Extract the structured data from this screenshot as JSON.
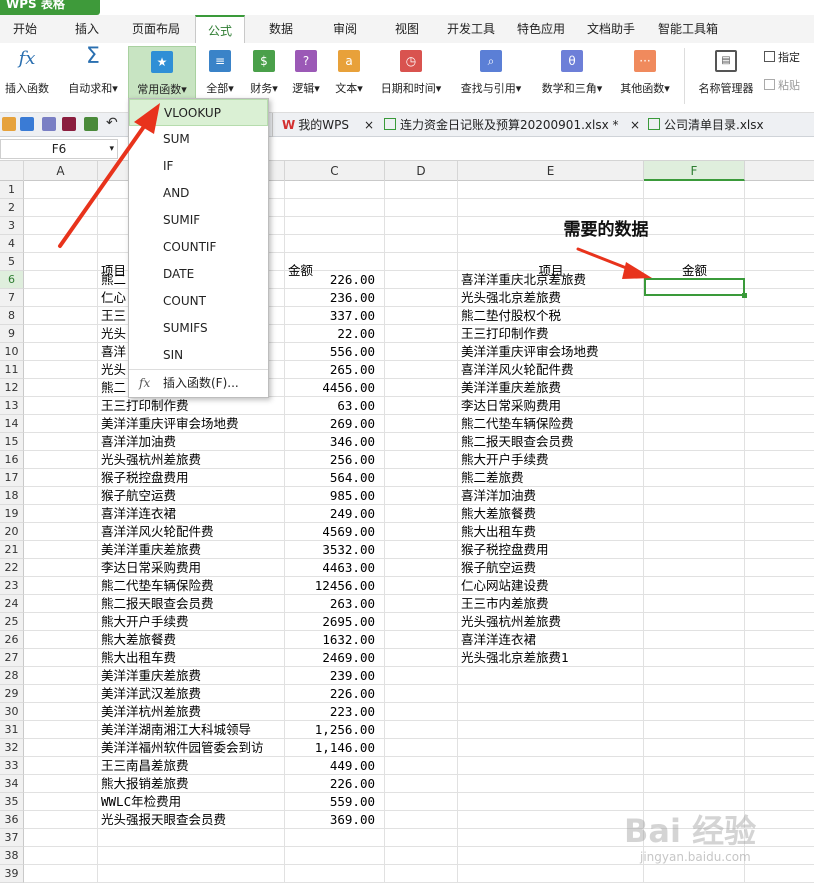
{
  "app": {
    "title": "WPS 表格"
  },
  "ribbon": {
    "tabs": [
      "开始",
      "插入",
      "页面布局",
      "公式",
      "数据",
      "审阅",
      "视图",
      "开发工具",
      "特色应用",
      "文档助手",
      "智能工具箱"
    ],
    "active": "公式"
  },
  "toolbar": {
    "insert_fn": "插入函数",
    "autosum": "自动求和",
    "common_fn": "常用函数",
    "all": "全部",
    "finance": "财务",
    "logic": "逻辑",
    "text": "文本",
    "datetime": "日期和时间",
    "lookup": "查找与引用",
    "math": "数学和三角",
    "other": "其他函数",
    "name_mgr": "名称管理器",
    "assign": "指定",
    "paste": "粘贴",
    "dropdown_glyph": "▾",
    "fx_glyph": "fx",
    "sigma_glyph": "Σ"
  },
  "doc_tabs": [
    "我的WPS",
    "连力资金日记账及预算20200901.xlsx *",
    "公司清单目录.xlsx"
  ],
  "formula_bar": {
    "cell_ref": "F6"
  },
  "columns": [
    "A",
    "B",
    "C",
    "D",
    "E",
    "F"
  ],
  "selected": {
    "col": "F",
    "row": 6
  },
  "menu": {
    "items": [
      "VLOOKUP",
      "SUM",
      "IF",
      "AND",
      "SUMIF",
      "COUNTIF",
      "DATE",
      "COUNT",
      "SUMIFS",
      "SIN"
    ],
    "insert_fn": "插入函数(F)..."
  },
  "sheet": {
    "title_right": "需要的数据",
    "header_item": "项目",
    "header_amount": "金额",
    "left_rows": [
      {
        "row": 6,
        "b": "熊二",
        "c": "226.00"
      },
      {
        "row": 7,
        "b": "仁心",
        "c": "236.00"
      },
      {
        "row": 8,
        "b": "王三",
        "c": "337.00"
      },
      {
        "row": 9,
        "b": "光头",
        "c": "22.00"
      },
      {
        "row": 10,
        "b": "喜洋",
        "c": "556.00"
      },
      {
        "row": 11,
        "b": "光头",
        "c": "265.00"
      },
      {
        "row": 12,
        "b": "熊二",
        "c": "4456.00"
      },
      {
        "row": 13,
        "b": "王三打印制作费",
        "c": "63.00"
      },
      {
        "row": 14,
        "b": "美洋洋重庆评审会场地费",
        "c": "269.00"
      },
      {
        "row": 15,
        "b": "喜洋洋加油费",
        "c": "346.00"
      },
      {
        "row": 16,
        "b": "光头强杭州差旅费",
        "c": "256.00"
      },
      {
        "row": 17,
        "b": "猴子税控盘费用",
        "c": "564.00"
      },
      {
        "row": 18,
        "b": "猴子航空运费",
        "c": "985.00"
      },
      {
        "row": 19,
        "b": "喜洋洋连衣裙",
        "c": "249.00"
      },
      {
        "row": 20,
        "b": "喜洋洋风火轮配件费",
        "c": "4569.00"
      },
      {
        "row": 21,
        "b": "美洋洋重庆差旅费",
        "c": "3532.00"
      },
      {
        "row": 22,
        "b": "李达日常采购费用",
        "c": "4463.00"
      },
      {
        "row": 23,
        "b": "熊二代垫车辆保险费",
        "c": "12456.00"
      },
      {
        "row": 24,
        "b": "熊二报天眼查会员费",
        "c": "263.00"
      },
      {
        "row": 25,
        "b": "熊大开户手续费",
        "c": "2695.00"
      },
      {
        "row": 26,
        "b": "熊大差旅餐费",
        "c": "1632.00"
      },
      {
        "row": 27,
        "b": "熊大出租车费",
        "c": "2469.00"
      },
      {
        "row": 28,
        "b": "美洋洋重庆差旅费",
        "c": "239.00"
      },
      {
        "row": 29,
        "b": "美洋洋武汉差旅费",
        "c": "226.00"
      },
      {
        "row": 30,
        "b": "美洋洋杭州差旅费",
        "c": "223.00"
      },
      {
        "row": 31,
        "b": "美洋洋湖南湘江大科城领导",
        "c": "1,256.00"
      },
      {
        "row": 32,
        "b": "美洋洋福州软件园管委会到访",
        "c": "1,146.00"
      },
      {
        "row": 33,
        "b": "王三南昌差旅费",
        "c": "449.00"
      },
      {
        "row": 34,
        "b": "熊大报销差旅费",
        "c": "226.00"
      },
      {
        "row": 35,
        "b": "WWLC年检费用",
        "c": "559.00"
      },
      {
        "row": 36,
        "b": "光头强报天眼查会员费",
        "c": "369.00"
      }
    ],
    "right_rows": [
      {
        "row": 6,
        "e": "喜洋洋重庆北京差旅费"
      },
      {
        "row": 7,
        "e": "光头强北京差旅费"
      },
      {
        "row": 8,
        "e": "熊二垫付股权个税"
      },
      {
        "row": 9,
        "e": "王三打印制作费"
      },
      {
        "row": 10,
        "e": "美洋洋重庆评审会场地费"
      },
      {
        "row": 11,
        "e": "喜洋洋风火轮配件费"
      },
      {
        "row": 12,
        "e": "美洋洋重庆差旅费"
      },
      {
        "row": 13,
        "e": "李达日常采购费用"
      },
      {
        "row": 14,
        "e": "熊二代垫车辆保险费"
      },
      {
        "row": 15,
        "e": "熊二报天眼查会员费"
      },
      {
        "row": 16,
        "e": "熊大开户手续费"
      },
      {
        "row": 17,
        "e": "熊二差旅费"
      },
      {
        "row": 18,
        "e": "喜洋洋加油费"
      },
      {
        "row": 19,
        "e": "熊大差旅餐费"
      },
      {
        "row": 20,
        "e": "熊大出租车费"
      },
      {
        "row": 21,
        "e": "猴子税控盘费用"
      },
      {
        "row": 22,
        "e": "猴子航空运费"
      },
      {
        "row": 23,
        "e": "仁心网站建设费"
      },
      {
        "row": 24,
        "e": "王三市内差旅费"
      },
      {
        "row": 25,
        "e": "光头强杭州差旅费"
      },
      {
        "row": 26,
        "e": "喜洋洋连衣裙"
      },
      {
        "row": 27,
        "e": "光头强北京差旅费1"
      }
    ]
  },
  "watermark": {
    "text": "Bai 经验",
    "sub": "jingyan.baidu.com"
  },
  "colors": {
    "accent": "#3a9a3a",
    "arrow": "#e8331c"
  }
}
